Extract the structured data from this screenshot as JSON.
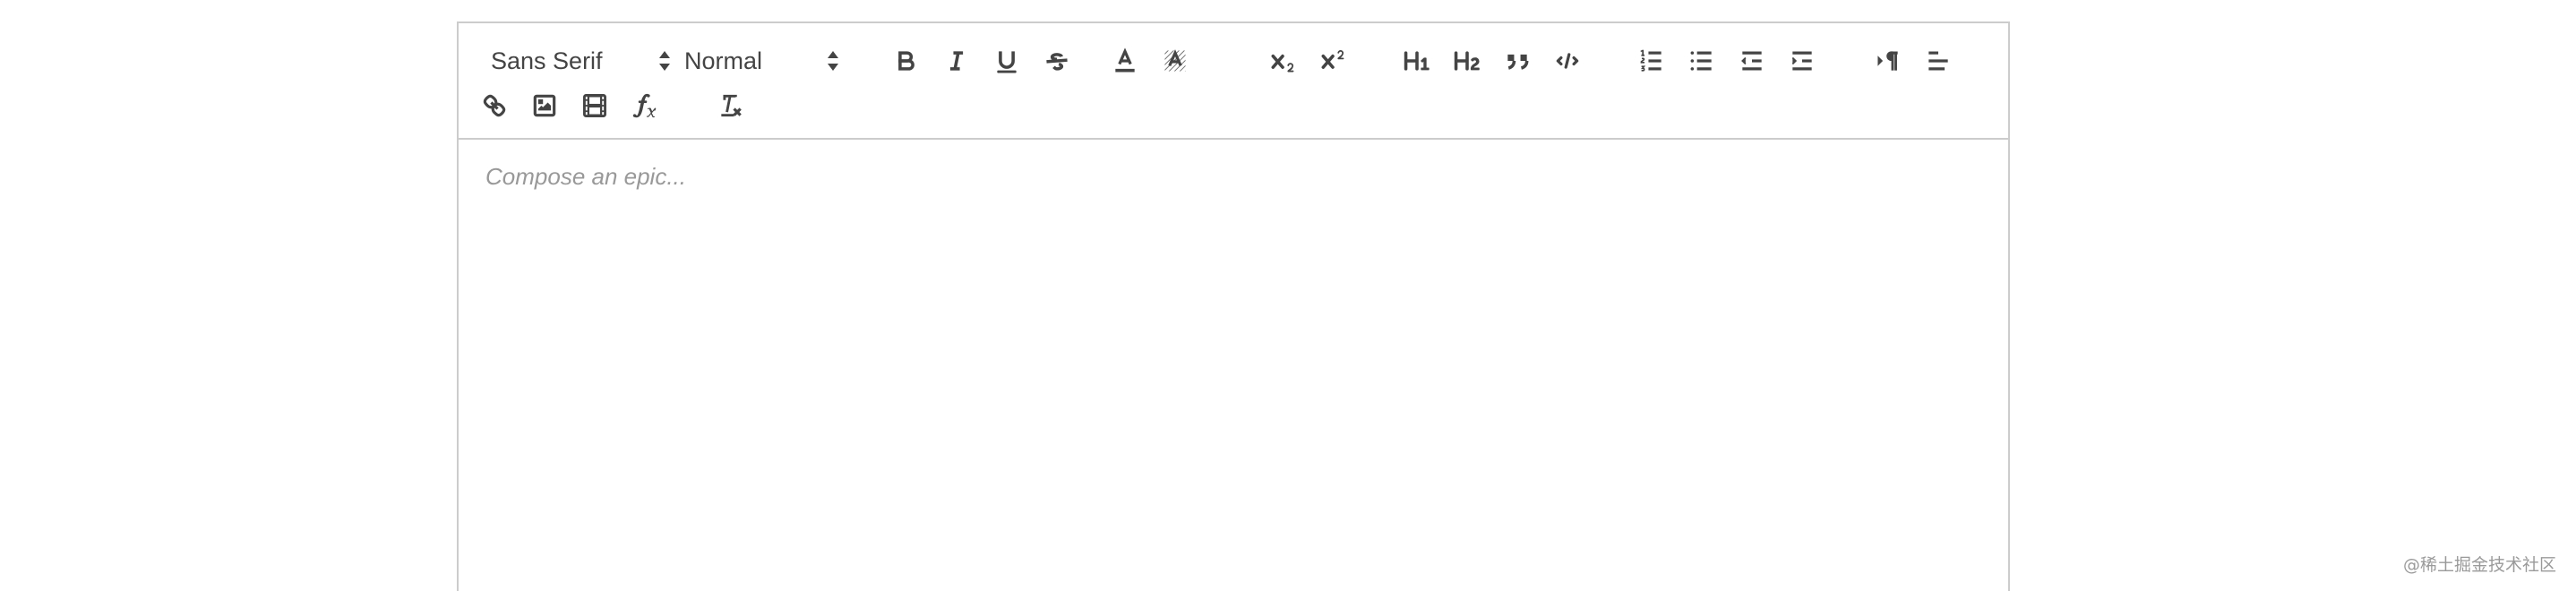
{
  "toolbar": {
    "font_picker": {
      "value": "Sans Serif"
    },
    "size_picker": {
      "value": "Normal"
    },
    "buttons": {
      "bold": {
        "icon": "bold-icon"
      },
      "italic": {
        "icon": "italic-icon"
      },
      "underline": {
        "icon": "underline-icon"
      },
      "strike": {
        "icon": "strikethrough-icon"
      },
      "color": {
        "icon": "text-color-icon"
      },
      "background": {
        "icon": "background-color-icon"
      },
      "subscript": {
        "icon": "subscript-icon"
      },
      "superscript": {
        "icon": "superscript-icon"
      },
      "header1": {
        "icon": "header-1-icon"
      },
      "header2": {
        "icon": "header-2-icon"
      },
      "blockquote": {
        "icon": "blockquote-icon"
      },
      "code_block": {
        "icon": "code-block-icon"
      },
      "ordered_list": {
        "icon": "ordered-list-icon"
      },
      "bullet_list": {
        "icon": "bullet-list-icon"
      },
      "outdent": {
        "icon": "outdent-icon"
      },
      "indent": {
        "icon": "indent-icon"
      },
      "direction": {
        "icon": "text-direction-icon"
      },
      "align": {
        "icon": "align-left-icon"
      },
      "link": {
        "icon": "link-icon"
      },
      "image": {
        "icon": "image-icon"
      },
      "video": {
        "icon": "video-icon"
      },
      "formula": {
        "icon": "formula-icon"
      },
      "clean": {
        "icon": "clear-formatting-icon"
      }
    }
  },
  "editor": {
    "placeholder": "Compose an epic..."
  },
  "watermark": {
    "text": "@稀土掘金技术社区"
  },
  "colors": {
    "border": "#cccccc",
    "icon": "#444444",
    "placeholder": "#999999"
  }
}
